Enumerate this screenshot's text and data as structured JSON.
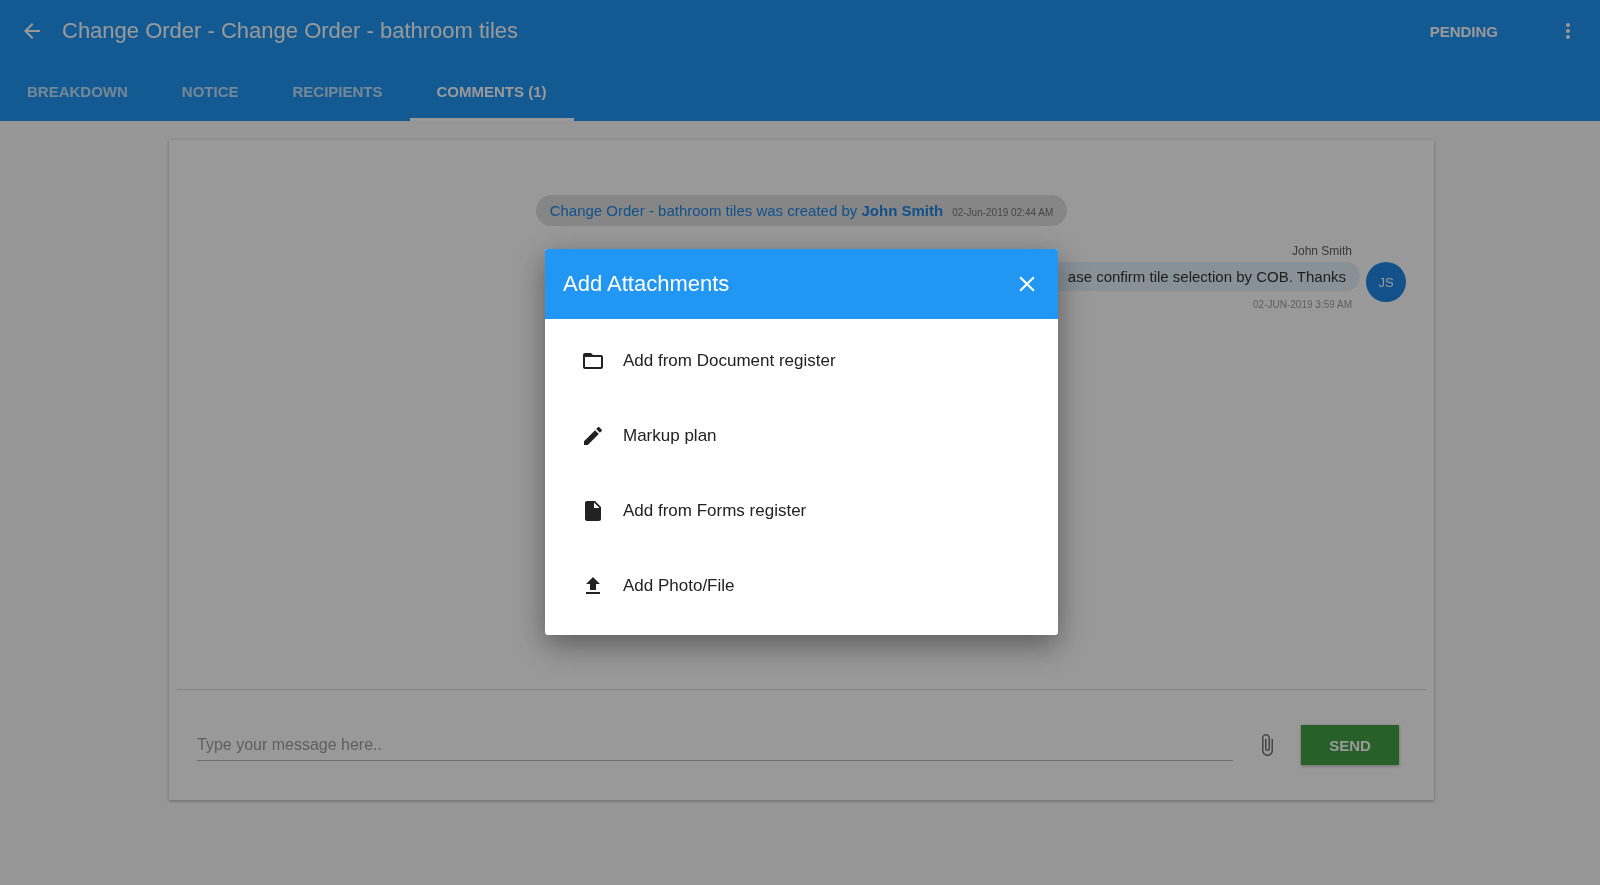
{
  "header": {
    "title": "Change Order - Change Order - bathroom tiles",
    "status": "PENDING"
  },
  "tabs": [
    {
      "label": "BREAKDOWN",
      "selected": false
    },
    {
      "label": "NOTICE",
      "selected": false
    },
    {
      "label": "RECIPIENTS",
      "selected": false
    },
    {
      "label": "COMMENTS (1)",
      "selected": true
    }
  ],
  "timeline": {
    "system_message": {
      "text": "Change Order - bathroom tiles was created by **John Smith**",
      "time": "02-Jun-2019 02:44 AM"
    },
    "messages": [
      {
        "author": "John Smith",
        "text": "ase confirm tile selection by COB. Thanks",
        "time": "02-JUN-2019 3:59 AM",
        "initials": "JS"
      }
    ]
  },
  "composer": {
    "placeholder": "Type your message here..",
    "send": "SEND"
  },
  "dialog": {
    "title": "Add Attachments",
    "options": [
      {
        "label": "Add from Document register",
        "kind": "folder"
      },
      {
        "label": "Markup plan",
        "kind": "pencil"
      },
      {
        "label": "Add from Forms register",
        "kind": "file"
      },
      {
        "label": "Add Photo/File",
        "kind": "upload"
      }
    ]
  }
}
